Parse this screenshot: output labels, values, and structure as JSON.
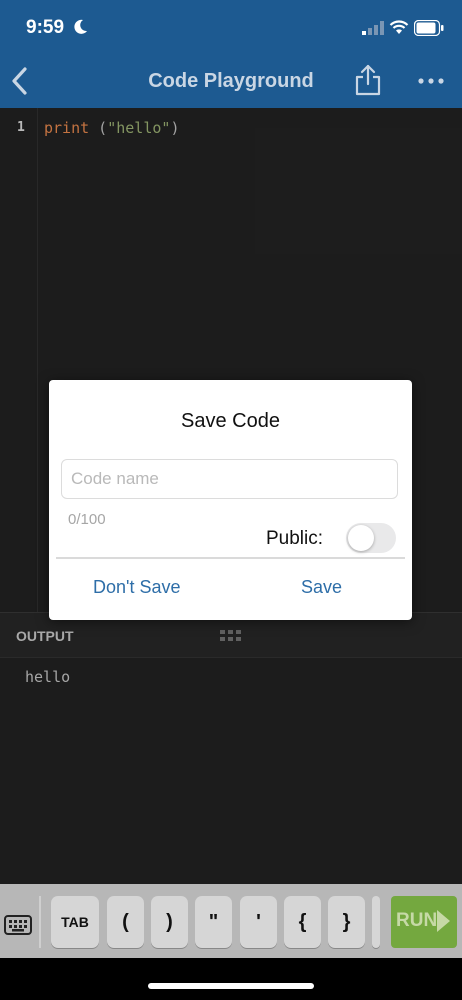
{
  "status_bar": {
    "time": "9:59"
  },
  "nav": {
    "title": "Code Playground"
  },
  "editor": {
    "line_number": "1",
    "code_keyword": "print",
    "code_paren_open": " (",
    "code_string": "\"hello\"",
    "code_paren_close": ")"
  },
  "output": {
    "label": "OUTPUT",
    "text": "hello"
  },
  "dialog": {
    "title": "Save Code",
    "name_placeholder": "Code name",
    "name_value": "",
    "counter": "0/100",
    "public_label": "Public:",
    "public_on": false,
    "dont_save_label": "Don't Save",
    "save_label": "Save"
  },
  "keyboard_bar": {
    "keys": [
      "TAB",
      "(",
      ")",
      "\"",
      "'",
      "{",
      "}"
    ],
    "run_label": "RUN"
  },
  "colors": {
    "nav_bar": "#1d5a91",
    "editor_bg": "#1f1f1f",
    "keyword": "#d57d47",
    "string": "#8fa26a",
    "dialog_button": "#2e6ea8",
    "run_button": "#74a83f"
  },
  "icons": {
    "back": "chevron-left-icon",
    "share": "share-icon",
    "more": "more-horizontal-icon",
    "keyboard": "keyboard-icon",
    "grip": "grip-icon"
  }
}
